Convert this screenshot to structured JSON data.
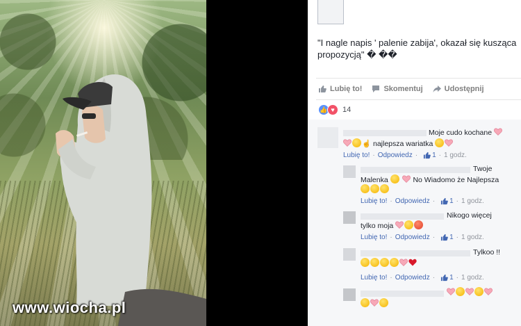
{
  "photo": {
    "watermark": "www.wiocha.pl"
  },
  "post": {
    "text": "\"I nagle napis ' palenie zabija', okazał się kusząca propozycją\" � ��",
    "actions": {
      "like": "Lubię to!",
      "comment": "Skomentuj",
      "share": "Udostępnij"
    },
    "reaction_count": "14"
  },
  "comments": [
    {
      "text_a": "Moje cudo kochane",
      "text_b": "najlepsza wariatka",
      "like": "Lubię to!",
      "reply": "Odpowiedz",
      "likes": "1",
      "time": "1 godz."
    },
    {
      "text_a": "Twoje",
      "text_b": "Malenka",
      "text_c": "No Wiadomo że Najlepsza",
      "like": "Lubię to!",
      "reply": "Odpowiedz",
      "likes": "1",
      "time": "1 godz."
    },
    {
      "text_a": "Nikogo więcej",
      "text_b": "tylko moja",
      "like": "Lubię to!",
      "reply": "Odpowiedz",
      "likes": "1",
      "time": "1 godz."
    },
    {
      "text_a": "Tylkoo !!",
      "like": "Lubię to!",
      "reply": "Odpowiedz",
      "likes": "1",
      "time": "1 godz."
    },
    {
      "text_a": "",
      "like": "",
      "reply": "",
      "likes": "",
      "time": ""
    }
  ],
  "colors": {
    "link": "#4267b2",
    "meta": "#90949c",
    "like_reaction": "#5890ff",
    "love_reaction": "#f25268"
  }
}
